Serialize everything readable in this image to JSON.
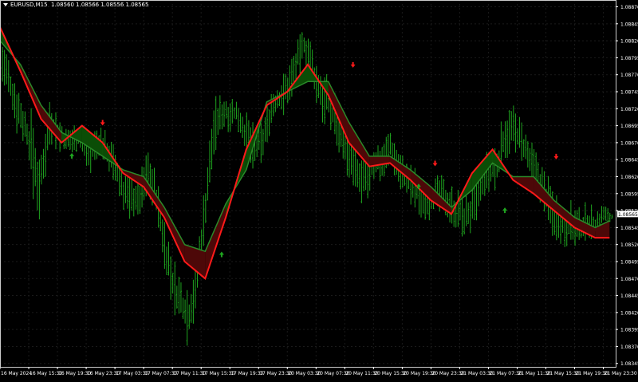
{
  "window": {
    "symbol_label": "EURUSD,M15",
    "ohlc_label": "1.08560 1.08566 1.08556 1.08565"
  },
  "colors": {
    "background": "#000000",
    "grid": "#1a1a1a",
    "bars": "#1fa51f",
    "fast_line": "#ff1a1a",
    "slow_line": "#2a8a2a",
    "fill_bull": "#0b4d06",
    "fill_bear": "#4d0808",
    "axis_text": "#ffffff",
    "price_tag_bg": "#ffffff",
    "price_tag_text": "#000000"
  },
  "chart_data": {
    "type": "line",
    "title": "EURUSD,M15",
    "current_price": "1.08565",
    "y_ticks": [
      "1.08870",
      "1.08845",
      "1.08820",
      "1.08795",
      "1.08770",
      "1.08745",
      "1.08720",
      "1.08695",
      "1.08670",
      "1.08645",
      "1.08620",
      "1.08595",
      "1.08570",
      "1.08545",
      "1.08520",
      "1.08495",
      "1.08470",
      "1.08445",
      "1.08420",
      "1.08395",
      "1.08370",
      "1.08345"
    ],
    "ylim": [
      1.0834,
      1.0888
    ],
    "x_ticks": [
      "16 May 2024",
      "16 May 15:30",
      "16 May 19:30",
      "16 May 23:30",
      "17 May 03:30",
      "17 May 07:30",
      "17 May 11:30",
      "17 May 15:30",
      "17 May 19:30",
      "17 May 23:30",
      "20 May 03:30",
      "20 May 07:30",
      "20 May 11:30",
      "20 May 15:30",
      "20 May 19:30",
      "20 May 23:30",
      "21 May 03:30",
      "21 May 07:30",
      "21 May 11:30",
      "21 May 15:30",
      "21 May 19:30",
      "21 May 23:30"
    ],
    "x_index": [
      0,
      14,
      28,
      42,
      56,
      70,
      84,
      98,
      112,
      126,
      140,
      154,
      168,
      182,
      196,
      210,
      224,
      238,
      252,
      266,
      280,
      294
    ],
    "x_count": 300,
    "series": [
      {
        "key": "fast",
        "x": [
          0,
          10,
          20,
          30,
          40,
          50,
          60,
          70,
          80,
          90,
          100,
          110,
          120,
          130,
          140,
          150,
          160,
          170,
          180,
          190,
          200,
          210,
          220,
          230,
          240,
          250,
          260,
          270,
          280,
          290,
          297
        ],
        "values": [
          1.0884,
          1.08775,
          1.08705,
          1.0867,
          1.08695,
          1.0867,
          1.08625,
          1.08605,
          1.0856,
          1.08495,
          1.0847,
          1.0856,
          1.0866,
          1.08725,
          1.08745,
          1.08785,
          1.0874,
          1.0867,
          1.08635,
          1.0864,
          1.08615,
          1.08585,
          1.08565,
          1.08625,
          1.0866,
          1.08615,
          1.08595,
          1.0857,
          1.08545,
          1.0853,
          1.0853
        ]
      },
      {
        "key": "slow",
        "x": [
          0,
          10,
          20,
          30,
          40,
          50,
          60,
          70,
          80,
          90,
          100,
          110,
          120,
          130,
          140,
          150,
          160,
          170,
          180,
          190,
          200,
          210,
          220,
          230,
          240,
          250,
          260,
          270,
          280,
          290,
          297
        ],
        "values": [
          1.0882,
          1.08785,
          1.08725,
          1.08685,
          1.0867,
          1.0865,
          1.0863,
          1.0862,
          1.08575,
          1.0852,
          1.0851,
          1.0858,
          1.0863,
          1.0873,
          1.08745,
          1.0876,
          1.0876,
          1.087,
          1.0865,
          1.0865,
          1.0863,
          1.08605,
          1.08575,
          1.086,
          1.0864,
          1.0862,
          1.0862,
          1.08585,
          1.0856,
          1.08545,
          1.08555
        ]
      }
    ],
    "arrows_up": [
      {
        "x": 35,
        "y": 1.0865
      },
      {
        "x": 108,
        "y": 1.08505
      },
      {
        "x": 204,
        "y": 1.08605
      },
      {
        "x": 246,
        "y": 1.0857
      }
    ],
    "arrows_down": [
      {
        "x": 50,
        "y": 1.087
      },
      {
        "x": 172,
        "y": 1.08785
      },
      {
        "x": 212,
        "y": 1.0864
      },
      {
        "x": 271,
        "y": 1.0865
      }
    ],
    "bar_ranges": [
      {
        "x": 0,
        "lo": 1.0876,
        "hi": 1.0883
      },
      {
        "x": 8,
        "lo": 1.0869,
        "hi": 1.0876
      },
      {
        "x": 12,
        "lo": 1.0867,
        "hi": 1.0872
      },
      {
        "x": 16,
        "lo": 1.0859,
        "hi": 1.0871
      },
      {
        "x": 19,
        "lo": 1.0856,
        "hi": 1.0864
      },
      {
        "x": 24,
        "lo": 1.0867,
        "hi": 1.0874
      },
      {
        "x": 28,
        "lo": 1.0866,
        "hi": 1.0871
      },
      {
        "x": 32,
        "lo": 1.0865,
        "hi": 1.0869
      },
      {
        "x": 38,
        "lo": 1.0866,
        "hi": 1.087
      },
      {
        "x": 44,
        "lo": 1.0863,
        "hi": 1.0868
      },
      {
        "x": 48,
        "lo": 1.0864,
        "hi": 1.087
      },
      {
        "x": 52,
        "lo": 1.0864,
        "hi": 1.0868
      },
      {
        "x": 56,
        "lo": 1.086,
        "hi": 1.0866
      },
      {
        "x": 60,
        "lo": 1.0857,
        "hi": 1.0863
      },
      {
        "x": 64,
        "lo": 1.0856,
        "hi": 1.0862
      },
      {
        "x": 68,
        "lo": 1.0856,
        "hi": 1.0862
      },
      {
        "x": 72,
        "lo": 1.086,
        "hi": 1.0866
      },
      {
        "x": 76,
        "lo": 1.0856,
        "hi": 1.0862
      },
      {
        "x": 80,
        "lo": 1.0848,
        "hi": 1.0856
      },
      {
        "x": 84,
        "lo": 1.0842,
        "hi": 1.085
      },
      {
        "x": 88,
        "lo": 1.084,
        "hi": 1.0847
      },
      {
        "x": 92,
        "lo": 1.0837,
        "hi": 1.0846
      },
      {
        "x": 96,
        "lo": 1.0844,
        "hi": 1.0851
      },
      {
        "x": 100,
        "lo": 1.0854,
        "hi": 1.0862
      },
      {
        "x": 104,
        "lo": 1.0865,
        "hi": 1.0873
      },
      {
        "x": 108,
        "lo": 1.0869,
        "hi": 1.0874
      },
      {
        "x": 112,
        "lo": 1.0869,
        "hi": 1.0874
      },
      {
        "x": 116,
        "lo": 1.0869,
        "hi": 1.0873
      },
      {
        "x": 120,
        "lo": 1.0865,
        "hi": 1.0871
      },
      {
        "x": 124,
        "lo": 1.0863,
        "hi": 1.0869
      },
      {
        "x": 128,
        "lo": 1.0865,
        "hi": 1.087
      },
      {
        "x": 132,
        "lo": 1.0869,
        "hi": 1.0875
      },
      {
        "x": 136,
        "lo": 1.0871,
        "hi": 1.0876
      },
      {
        "x": 140,
        "lo": 1.0872,
        "hi": 1.0878
      },
      {
        "x": 144,
        "lo": 1.0876,
        "hi": 1.0881
      },
      {
        "x": 148,
        "lo": 1.0879,
        "hi": 1.0884
      },
      {
        "x": 150,
        "lo": 1.0878,
        "hi": 1.0883
      },
      {
        "x": 154,
        "lo": 1.0872,
        "hi": 1.0879
      },
      {
        "x": 158,
        "lo": 1.087,
        "hi": 1.0877
      },
      {
        "x": 162,
        "lo": 1.0869,
        "hi": 1.0875
      },
      {
        "x": 166,
        "lo": 1.0865,
        "hi": 1.0872
      },
      {
        "x": 170,
        "lo": 1.0861,
        "hi": 1.0868
      },
      {
        "x": 174,
        "lo": 1.0859,
        "hi": 1.0865
      },
      {
        "x": 178,
        "lo": 1.0858,
        "hi": 1.0864
      },
      {
        "x": 182,
        "lo": 1.0861,
        "hi": 1.0867
      },
      {
        "x": 186,
        "lo": 1.0862,
        "hi": 1.0867
      },
      {
        "x": 190,
        "lo": 1.0864,
        "hi": 1.0869
      },
      {
        "x": 194,
        "lo": 1.0861,
        "hi": 1.0866
      },
      {
        "x": 198,
        "lo": 1.0859,
        "hi": 1.0864
      },
      {
        "x": 202,
        "lo": 1.0857,
        "hi": 1.0863
      },
      {
        "x": 206,
        "lo": 1.0856,
        "hi": 1.0861
      },
      {
        "x": 210,
        "lo": 1.0856,
        "hi": 1.0861
      },
      {
        "x": 214,
        "lo": 1.0857,
        "hi": 1.0862
      },
      {
        "x": 218,
        "lo": 1.0856,
        "hi": 1.0861
      },
      {
        "x": 222,
        "lo": 1.0854,
        "hi": 1.086
      },
      {
        "x": 226,
        "lo": 1.0853,
        "hi": 1.0859
      },
      {
        "x": 230,
        "lo": 1.0854,
        "hi": 1.086
      },
      {
        "x": 234,
        "lo": 1.0857,
        "hi": 1.0863
      },
      {
        "x": 238,
        "lo": 1.0859,
        "hi": 1.0866
      },
      {
        "x": 242,
        "lo": 1.086,
        "hi": 1.0867
      },
      {
        "x": 246,
        "lo": 1.0865,
        "hi": 1.0872
      },
      {
        "x": 250,
        "lo": 1.0866,
        "hi": 1.0872
      },
      {
        "x": 254,
        "lo": 1.0864,
        "hi": 1.087
      },
      {
        "x": 258,
        "lo": 1.0861,
        "hi": 1.0867
      },
      {
        "x": 262,
        "lo": 1.0859,
        "hi": 1.0865
      },
      {
        "x": 266,
        "lo": 1.0856,
        "hi": 1.0862
      },
      {
        "x": 270,
        "lo": 1.0853,
        "hi": 1.086
      },
      {
        "x": 274,
        "lo": 1.0852,
        "hi": 1.0858
      },
      {
        "x": 278,
        "lo": 1.0852,
        "hi": 1.0858
      },
      {
        "x": 282,
        "lo": 1.0851,
        "hi": 1.0857
      },
      {
        "x": 286,
        "lo": 1.0853,
        "hi": 1.0858
      },
      {
        "x": 290,
        "lo": 1.0853,
        "hi": 1.0857
      },
      {
        "x": 294,
        "lo": 1.0855,
        "hi": 1.0858
      },
      {
        "x": 298,
        "lo": 1.08556,
        "hi": 1.08566
      }
    ]
  }
}
